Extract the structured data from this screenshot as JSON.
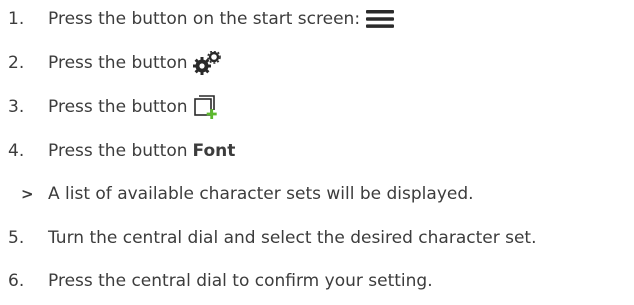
{
  "steps": [
    {
      "number": "1.",
      "text": "Press the button on the start screen:",
      "icon": "menu-icon"
    },
    {
      "number": "2.",
      "text": "Press the button",
      "icon": "gears-icon"
    },
    {
      "number": "3.",
      "text": "Press the button",
      "icon": "add-window-icon"
    },
    {
      "number": "4.",
      "text": "Press the button",
      "bold": "Font"
    },
    {
      "marker": ">",
      "text": "A list of available character sets will be displayed."
    },
    {
      "number": "5.",
      "text": "Turn the central dial and select the desired character set."
    },
    {
      "number": "6.",
      "text": "Press the central dial to confirm your setting."
    }
  ],
  "colors": {
    "text": "#3c3c3c",
    "icon": "#2a2a2a",
    "icon_accent": "#5cb82e"
  }
}
